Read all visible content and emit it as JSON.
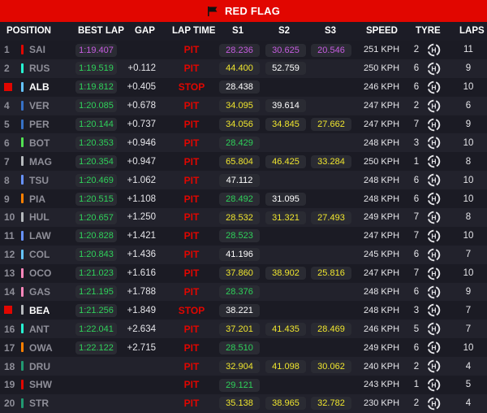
{
  "banner": {
    "label": "RED FLAG",
    "icon": "checkered-flag-icon",
    "color": "#e10600"
  },
  "headers": {
    "position": "POSITION",
    "best_lap": "BEST LAP",
    "gap": "GAP",
    "lap_time": "LAP TIME",
    "s1": "S1",
    "s2": "S2",
    "s3": "S3",
    "speed": "SPEED",
    "tyre": "TYRE",
    "laps": "LAPS"
  },
  "colors": {
    "purple": "#c65ce0",
    "green": "#2fd15a",
    "yellow": "#f0e62e",
    "red": "#e10600"
  },
  "rows": [
    {
      "pos": "1",
      "code": "SAI",
      "team": "#e10600",
      "best": "1:19.407",
      "best_c": "purple",
      "gap": "",
      "status": "PIT",
      "s1": "28.236",
      "s1c": "purple",
      "s2": "30.625",
      "s2c": "purple",
      "s3": "20.546",
      "s3c": "purple",
      "speed": "251 KPH",
      "tcount": "2",
      "tyre": "H",
      "laps": "11",
      "out": false
    },
    {
      "pos": "2",
      "code": "RUS",
      "team": "#27f4d2",
      "best": "1:19.519",
      "best_c": "green",
      "gap": "+0.112",
      "status": "PIT",
      "s1": "44.400",
      "s1c": "yellow",
      "s2": "52.759",
      "s2c": "white",
      "s3": "",
      "s3c": "",
      "speed": "250 KPH",
      "tcount": "6",
      "tyre": "H",
      "laps": "9",
      "out": false
    },
    {
      "pos": "",
      "code": "ALB",
      "team": "#64c4ff",
      "best": "1:19.812",
      "best_c": "green",
      "gap": "+0.405",
      "status": "STOP",
      "s1": "28.438",
      "s1c": "white",
      "s2": "",
      "s2c": "",
      "s3": "",
      "s3c": "",
      "speed": "246 KPH",
      "tcount": "6",
      "tyre": "H",
      "laps": "10",
      "out": true
    },
    {
      "pos": "4",
      "code": "VER",
      "team": "#3671c6",
      "best": "1:20.085",
      "best_c": "green",
      "gap": "+0.678",
      "status": "PIT",
      "s1": "34.095",
      "s1c": "yellow",
      "s2": "39.614",
      "s2c": "white",
      "s3": "",
      "s3c": "",
      "speed": "247 KPH",
      "tcount": "2",
      "tyre": "H",
      "laps": "6",
      "out": false
    },
    {
      "pos": "5",
      "code": "PER",
      "team": "#3671c6",
      "best": "1:20.144",
      "best_c": "green",
      "gap": "+0.737",
      "status": "PIT",
      "s1": "34.056",
      "s1c": "yellow",
      "s2": "34.845",
      "s2c": "yellow",
      "s3": "27.662",
      "s3c": "yellow",
      "speed": "247 KPH",
      "tcount": "7",
      "tyre": "H",
      "laps": "9",
      "out": false
    },
    {
      "pos": "6",
      "code": "BOT",
      "team": "#52e252",
      "best": "1:20.353",
      "best_c": "green",
      "gap": "+0.946",
      "status": "PIT",
      "s1": "28.429",
      "s1c": "green",
      "s2": "",
      "s2c": "",
      "s3": "",
      "s3c": "",
      "speed": "248 KPH",
      "tcount": "3",
      "tyre": "H",
      "laps": "10",
      "out": false
    },
    {
      "pos": "7",
      "code": "MAG",
      "team": "#b6babd",
      "best": "1:20.354",
      "best_c": "green",
      "gap": "+0.947",
      "status": "PIT",
      "s1": "65.804",
      "s1c": "yellow",
      "s2": "46.425",
      "s2c": "yellow",
      "s3": "33.284",
      "s3c": "yellow",
      "speed": "250 KPH",
      "tcount": "1",
      "tyre": "H",
      "laps": "8",
      "out": false
    },
    {
      "pos": "8",
      "code": "TSU",
      "team": "#6692ff",
      "best": "1:20.469",
      "best_c": "green",
      "gap": "+1.062",
      "status": "PIT",
      "s1": "47.112",
      "s1c": "white",
      "s2": "",
      "s2c": "",
      "s3": "",
      "s3c": "",
      "speed": "248 KPH",
      "tcount": "6",
      "tyre": "H",
      "laps": "10",
      "out": false
    },
    {
      "pos": "9",
      "code": "PIA",
      "team": "#ff8000",
      "best": "1:20.515",
      "best_c": "green",
      "gap": "+1.108",
      "status": "PIT",
      "s1": "28.492",
      "s1c": "green",
      "s2": "31.095",
      "s2c": "white",
      "s3": "",
      "s3c": "",
      "speed": "248 KPH",
      "tcount": "6",
      "tyre": "H",
      "laps": "10",
      "out": false
    },
    {
      "pos": "10",
      "code": "HUL",
      "team": "#b6babd",
      "best": "1:20.657",
      "best_c": "green",
      "gap": "+1.250",
      "status": "PIT",
      "s1": "28.532",
      "s1c": "yellow",
      "s2": "31.321",
      "s2c": "yellow",
      "s3": "27.493",
      "s3c": "yellow",
      "speed": "249 KPH",
      "tcount": "7",
      "tyre": "H",
      "laps": "8",
      "out": false
    },
    {
      "pos": "11",
      "code": "LAW",
      "team": "#6692ff",
      "best": "1:20.828",
      "best_c": "green",
      "gap": "+1.421",
      "status": "PIT",
      "s1": "28.523",
      "s1c": "green",
      "s2": "",
      "s2c": "",
      "s3": "",
      "s3c": "",
      "speed": "247 KPH",
      "tcount": "7",
      "tyre": "H",
      "laps": "10",
      "out": false
    },
    {
      "pos": "12",
      "code": "COL",
      "team": "#64c4ff",
      "best": "1:20.843",
      "best_c": "green",
      "gap": "+1.436",
      "status": "PIT",
      "s1": "41.196",
      "s1c": "white",
      "s2": "",
      "s2c": "",
      "s3": "",
      "s3c": "",
      "speed": "245 KPH",
      "tcount": "6",
      "tyre": "H",
      "laps": "7",
      "out": false
    },
    {
      "pos": "13",
      "code": "OCO",
      "team": "#ff87bc",
      "best": "1:21.023",
      "best_c": "green",
      "gap": "+1.616",
      "status": "PIT",
      "s1": "37.860",
      "s1c": "yellow",
      "s2": "38.902",
      "s2c": "yellow",
      "s3": "25.816",
      "s3c": "yellow",
      "speed": "247 KPH",
      "tcount": "7",
      "tyre": "H",
      "laps": "10",
      "out": false
    },
    {
      "pos": "14",
      "code": "GAS",
      "team": "#ff87bc",
      "best": "1:21.195",
      "best_c": "green",
      "gap": "+1.788",
      "status": "PIT",
      "s1": "28.376",
      "s1c": "green",
      "s2": "",
      "s2c": "",
      "s3": "",
      "s3c": "",
      "speed": "248 KPH",
      "tcount": "6",
      "tyre": "H",
      "laps": "9",
      "out": false
    },
    {
      "pos": "",
      "code": "BEA",
      "team": "#b6babd",
      "best": "1:21.256",
      "best_c": "green",
      "gap": "+1.849",
      "status": "STOP",
      "s1": "38.221",
      "s1c": "white",
      "s2": "",
      "s2c": "",
      "s3": "",
      "s3c": "",
      "speed": "248 KPH",
      "tcount": "3",
      "tyre": "H",
      "laps": "7",
      "out": true
    },
    {
      "pos": "16",
      "code": "ANT",
      "team": "#27f4d2",
      "best": "1:22.041",
      "best_c": "green",
      "gap": "+2.634",
      "status": "PIT",
      "s1": "37.201",
      "s1c": "yellow",
      "s2": "41.435",
      "s2c": "yellow",
      "s3": "28.469",
      "s3c": "yellow",
      "speed": "246 KPH",
      "tcount": "5",
      "tyre": "H",
      "laps": "7",
      "out": false
    },
    {
      "pos": "17",
      "code": "OWA",
      "team": "#ff8000",
      "best": "1:22.122",
      "best_c": "green",
      "gap": "+2.715",
      "status": "PIT",
      "s1": "28.510",
      "s1c": "green",
      "s2": "",
      "s2c": "",
      "s3": "",
      "s3c": "",
      "speed": "249 KPH",
      "tcount": "6",
      "tyre": "H",
      "laps": "10",
      "out": false
    },
    {
      "pos": "18",
      "code": "DRU",
      "team": "#229971",
      "best": "",
      "best_c": "",
      "gap": "",
      "status": "PIT",
      "s1": "32.904",
      "s1c": "yellow",
      "s2": "41.098",
      "s2c": "yellow",
      "s3": "30.062",
      "s3c": "yellow",
      "speed": "240 KPH",
      "tcount": "2",
      "tyre": "H",
      "laps": "4",
      "out": false
    },
    {
      "pos": "19",
      "code": "SHW",
      "team": "#e10600",
      "best": "",
      "best_c": "",
      "gap": "",
      "status": "PIT",
      "s1": "29.121",
      "s1c": "green",
      "s2": "",
      "s2c": "",
      "s3": "",
      "s3c": "",
      "speed": "243 KPH",
      "tcount": "1",
      "tyre": "H",
      "laps": "5",
      "out": false
    },
    {
      "pos": "20",
      "code": "STR",
      "team": "#229971",
      "best": "",
      "best_c": "",
      "gap": "",
      "status": "PIT",
      "s1": "35.138",
      "s1c": "yellow",
      "s2": "38.965",
      "s2c": "yellow",
      "s3": "32.782",
      "s3c": "yellow",
      "speed": "230 KPH",
      "tcount": "2",
      "tyre": "H",
      "laps": "4",
      "out": false
    }
  ]
}
